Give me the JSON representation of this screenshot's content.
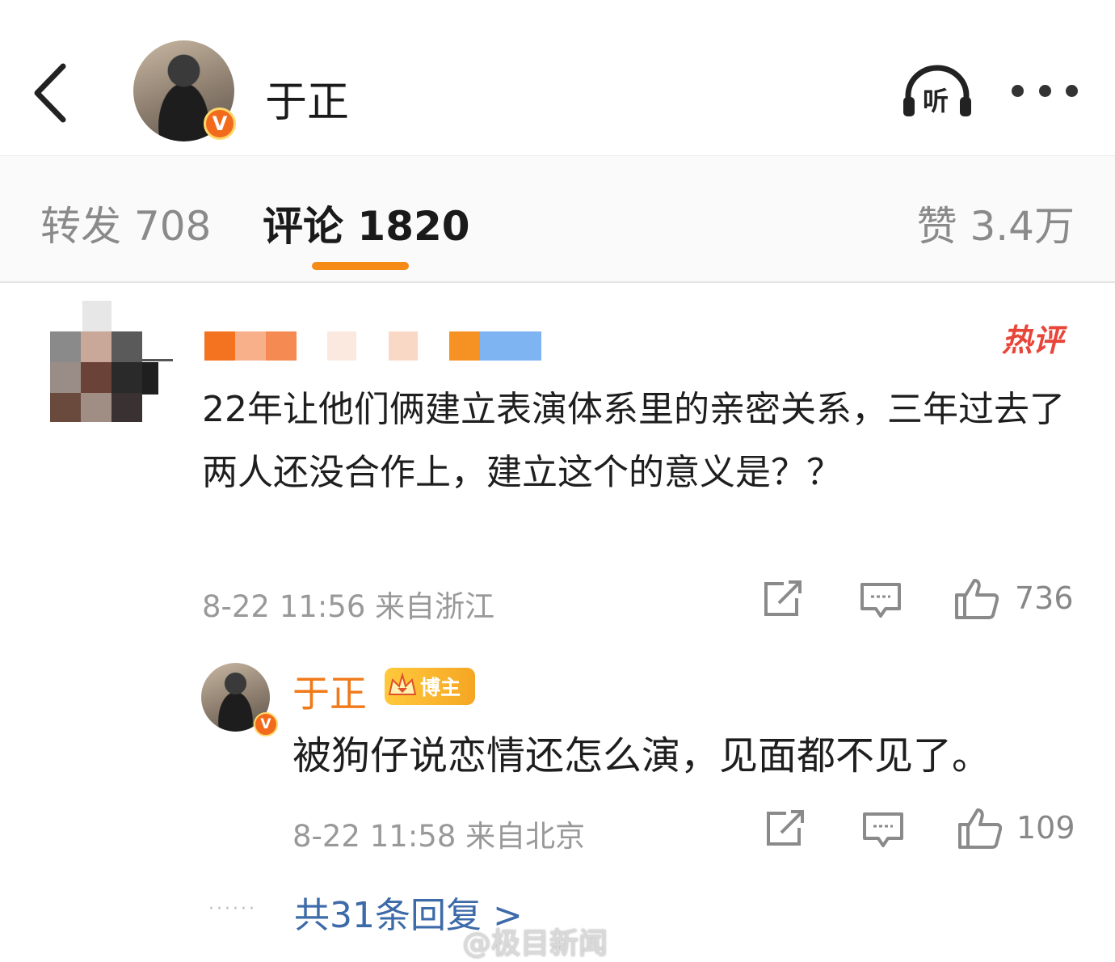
{
  "header": {
    "title": "于正",
    "verified_badge": "V",
    "listen_label": "听",
    "back_icon": "chevron-left-icon",
    "more_icon": "more-dots-icon"
  },
  "tabs": {
    "repost": "转发 708",
    "comment": "评论 1820",
    "like": "赞 3.4万",
    "active": "comment"
  },
  "comments": [
    {
      "hot_label": "热评",
      "text": "22年让他们俩建立表演体系里的亲密关系，三年过去了两人还没合作上，建立这个的意义是？？",
      "meta": "8-22 11:56 来自浙江",
      "likes": "736"
    }
  ],
  "reply": {
    "name": "于正",
    "verified_badge": "V",
    "author_badge": "博主",
    "text": "被狗仔说恋情还怎么演，见面都不见了。",
    "meta": "8-22 11:58 来自北京",
    "likes": "109"
  },
  "more_replies": {
    "leader": "······",
    "label": "共31条回复 >"
  },
  "watermark": "@极目新闻",
  "colors": {
    "accent": "#f58a16",
    "author_name": "#f07a1a",
    "link": "#3d6aa8",
    "hot": "#e8463a"
  }
}
